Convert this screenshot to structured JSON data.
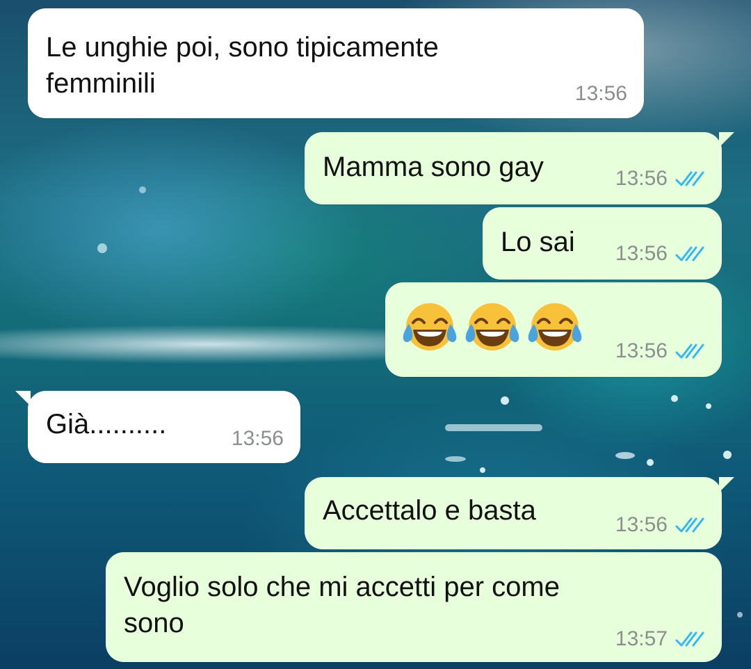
{
  "colors": {
    "incoming_bubble": "#ffffff",
    "outgoing_bubble": "#e7ffdb",
    "timestamp": "#8a8f8c",
    "read_ticks": "#34b7f1",
    "emoji_face": "#f7c13a",
    "emoji_tears": "#4aa3df"
  },
  "messages": [
    {
      "direction": "incoming",
      "text": "Le unghie poi, sono tipicamente\nfemminili",
      "time": "13:56"
    },
    {
      "direction": "outgoing",
      "text": "Mamma sono gay",
      "time": "13:56",
      "status": "read"
    },
    {
      "direction": "outgoing",
      "text": "Lo sai",
      "time": "13:56",
      "status": "read"
    },
    {
      "direction": "outgoing",
      "emoji": [
        "face-with-tears-of-joy",
        "face-with-tears-of-joy",
        "face-with-tears-of-joy"
      ],
      "time": "13:56",
      "status": "read"
    },
    {
      "direction": "incoming",
      "text": "Già..........",
      "time": "13:56"
    },
    {
      "direction": "outgoing",
      "text": "Accettalo e basta",
      "time": "13:56",
      "status": "read"
    },
    {
      "direction": "outgoing",
      "text": "Voglio solo che mi accetti per come\nsono",
      "time": "13:57",
      "status": "read"
    }
  ],
  "icons": {
    "read_status": "double-check-icon",
    "emoji": "face-with-tears-of-joy"
  }
}
